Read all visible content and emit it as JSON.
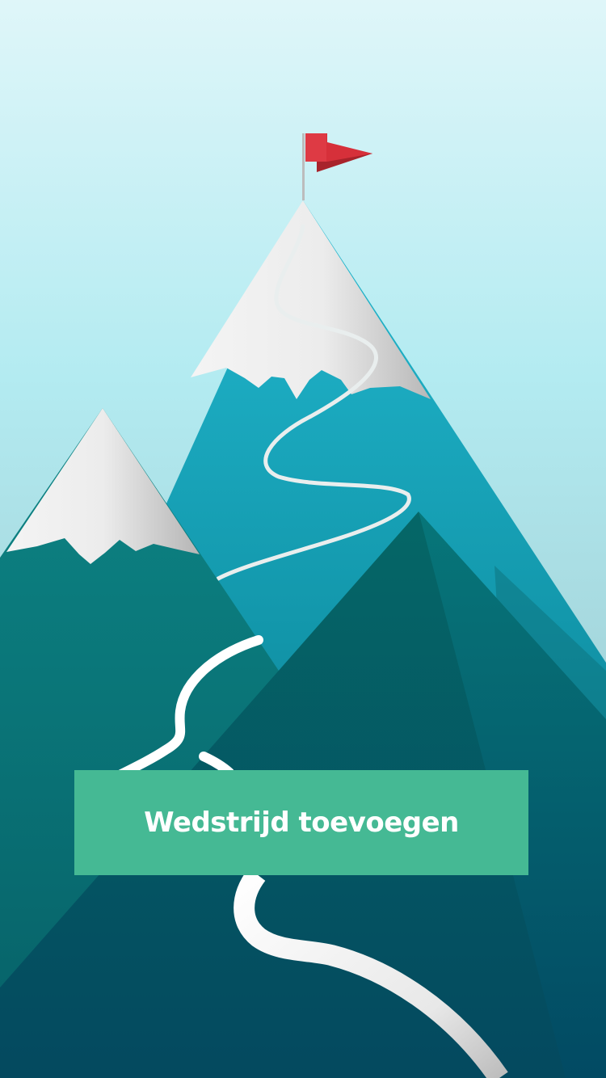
{
  "cta": {
    "label": "Wedstrijd toevoegen"
  },
  "colors": {
    "sky_top": "#dcf5f8",
    "sky_mid": "#b0e8ef",
    "sky_bottom": "#9fc9cf",
    "main_mountain_top": "#1fb3cb",
    "main_mountain_bottom": "#0b6a7d",
    "left_mountain": "#0c7d80",
    "front_mountain": "#045a67",
    "front_mountain_right": "#06708a",
    "snow": "#f2f2f2",
    "snow_shade": "#bdbdbd",
    "flag": "#d6303a",
    "flag_shade": "#a8232b",
    "path": "#ffffff",
    "button": "#45b994"
  },
  "icons": {
    "summit_flag": "flag-icon"
  }
}
